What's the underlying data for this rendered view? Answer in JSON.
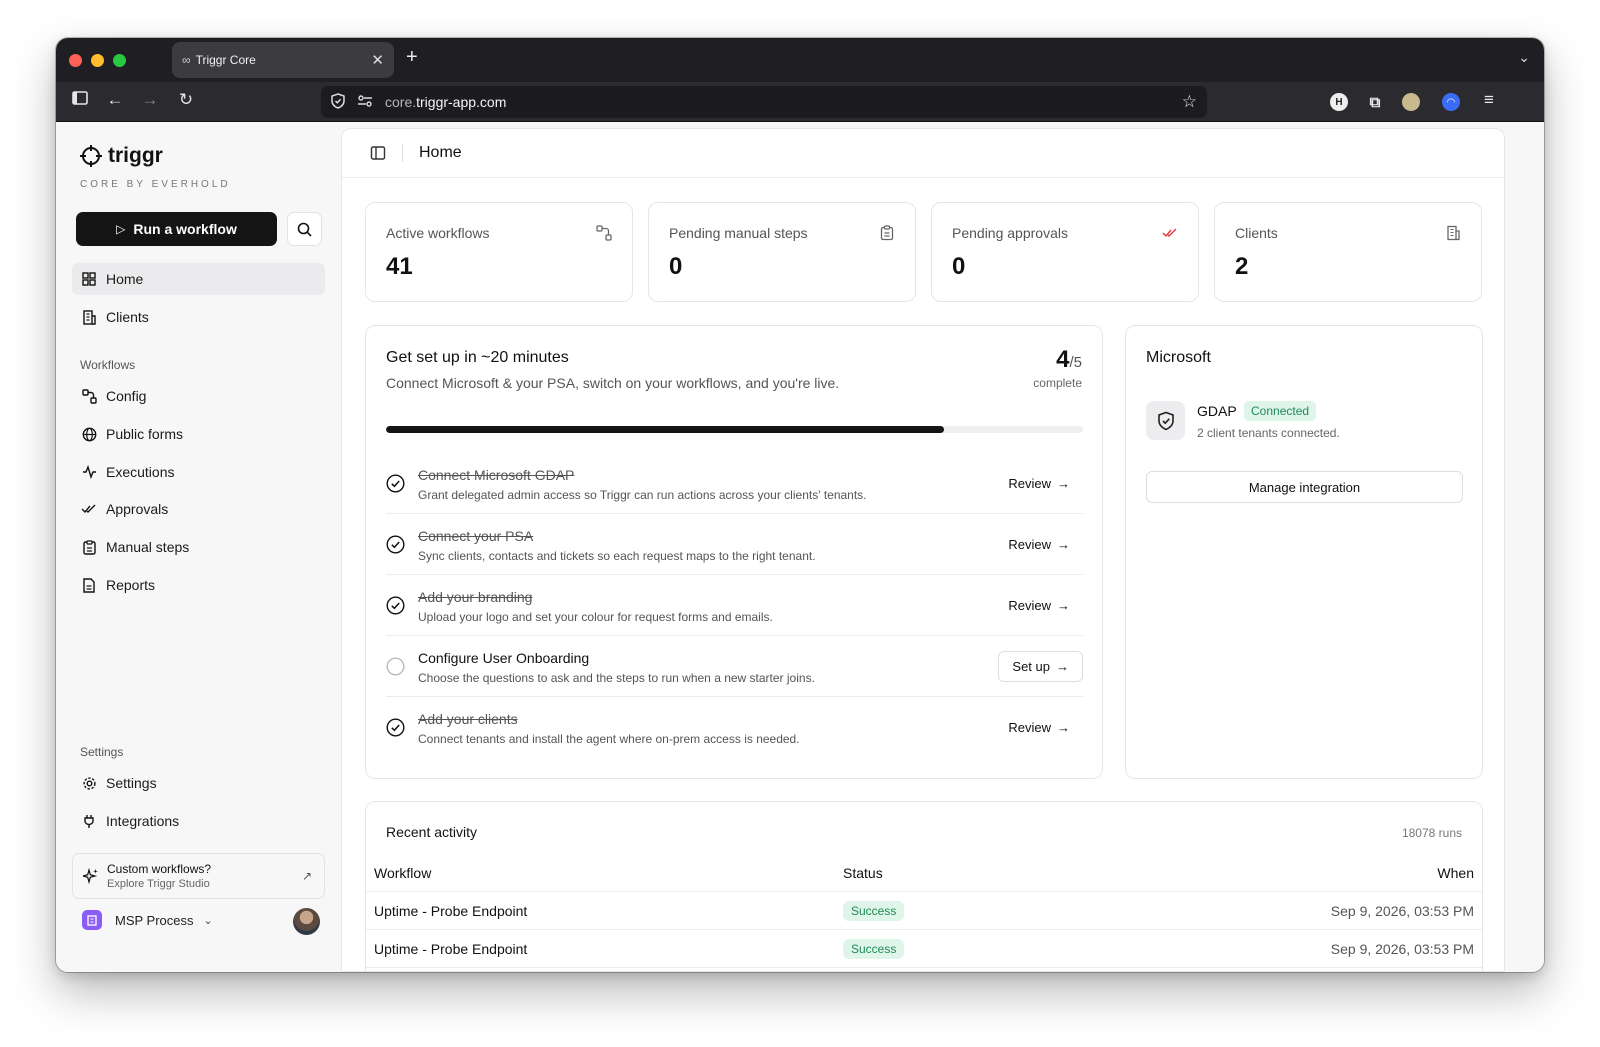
{
  "browser": {
    "tab_title": "Triggr Core",
    "url_prefix": "core.",
    "url_host": "triggr-app.com"
  },
  "sidebar": {
    "brand": "triggr",
    "brand_sub": "CORE BY EVERHOLD",
    "run_label": "Run a workflow",
    "items_top": [
      {
        "label": "Home",
        "icon": "grid-icon"
      },
      {
        "label": "Clients",
        "icon": "building-icon"
      }
    ],
    "section_workflows": "Workflows",
    "items_workflows": [
      {
        "label": "Config",
        "icon": "workflow-icon"
      },
      {
        "label": "Public forms",
        "icon": "globe-icon"
      },
      {
        "label": "Executions",
        "icon": "activity-icon"
      },
      {
        "label": "Approvals",
        "icon": "check-double-icon"
      },
      {
        "label": "Manual steps",
        "icon": "clipboard-icon"
      },
      {
        "label": "Reports",
        "icon": "document-icon"
      }
    ],
    "section_settings": "Settings",
    "items_settings": [
      {
        "label": "Settings",
        "icon": "gear-icon"
      },
      {
        "label": "Integrations",
        "icon": "plug-icon"
      }
    ],
    "promo_title": "Custom workflows?",
    "promo_sub": "Explore Triggr Studio",
    "org_name": "MSP Process"
  },
  "header": {
    "title": "Home"
  },
  "stats": [
    {
      "label": "Active workflows",
      "value": "41"
    },
    {
      "label": "Pending manual steps",
      "value": "0"
    },
    {
      "label": "Pending approvals",
      "value": "0"
    },
    {
      "label": "Clients",
      "value": "2"
    }
  ],
  "setup": {
    "title": "Get set up in ~20 minutes",
    "subtitle": "Connect Microsoft & your PSA, switch on your workflows, and you're live.",
    "done": "4",
    "total": "/5",
    "complete_label": "complete",
    "progress": 0.8,
    "steps": [
      {
        "title": "Connect Microsoft GDAP",
        "desc": "Grant delegated admin access so Triggr can run actions across your clients' tenants.",
        "done": true,
        "action": "Review"
      },
      {
        "title": "Connect your PSA",
        "desc": "Sync clients, contacts and tickets so each request maps to the right tenant.",
        "done": true,
        "action": "Review"
      },
      {
        "title": "Add your branding",
        "desc": "Upload your logo and set your colour for request forms and emails.",
        "done": true,
        "action": "Review"
      },
      {
        "title": "Configure User Onboarding",
        "desc": "Choose the questions to ask and the steps to run when a new starter joins.",
        "done": false,
        "action": "Set up"
      },
      {
        "title": "Add your clients",
        "desc": "Connect tenants and install the agent where on-prem access is needed.",
        "done": true,
        "action": "Review"
      }
    ]
  },
  "microsoft": {
    "title": "Microsoft",
    "integration_name": "GDAP",
    "status": "Connected",
    "detail": "2 client tenants connected.",
    "button": "Manage integration"
  },
  "activity": {
    "title": "Recent activity",
    "count": "18078 runs",
    "columns": {
      "workflow": "Workflow",
      "status": "Status",
      "when": "When"
    },
    "rows": [
      {
        "workflow": "Uptime - Probe Endpoint",
        "status": "Success",
        "when": "Sep 9, 2026, 03:53 PM"
      },
      {
        "workflow": "Uptime - Probe Endpoint",
        "status": "Success",
        "when": "Sep 9, 2026, 03:53 PM"
      }
    ]
  },
  "colors": {
    "accent": "#141414",
    "success_bg": "#dff5ea",
    "success_text": "#1e8a55",
    "approval_red": "#e0393e",
    "org_badge": "#8b5cf6"
  }
}
